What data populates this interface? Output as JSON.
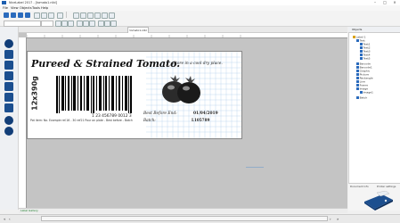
{
  "window": {
    "title": "NiceLabel 2017 - [tomato1.nlbl]"
  },
  "menu": {
    "items": [
      "File",
      "View",
      "Objects",
      "Tools",
      "Help"
    ]
  },
  "document": {
    "tab_label": "tomato1.nlbl"
  },
  "label": {
    "title": "Pureed & Strained Tomato.",
    "weight": "12x390g",
    "barcode_number": "1 23 456789 0012 3",
    "footnote": "Pot item: No. Example ref.16 - 30 ref21 Pour on plate - Best before - Batch",
    "store_text": "Store in a cool dry place.",
    "best_before_label": "Best Before End:",
    "best_before_value": "01/04/2019",
    "batch_label": "Batch:",
    "batch_value": "L105789"
  },
  "colors": {
    "accent": "#1c4f8f",
    "canvas": "#c4c4c4",
    "gallery": "#1b7e2a"
  },
  "bottom": {
    "gallery_label": "Label Gallery"
  },
  "right_panel": {
    "tab_label": "Objects",
    "tree": [
      "Label 1",
      "Text",
      "Text1",
      "Text2",
      "Text3",
      "Text4",
      "Text5",
      "Barcode",
      "Barcode1",
      "Graphic",
      "Picture",
      "Rectangle",
      "Line",
      "Frame",
      "Image",
      "Image1",
      "Batch"
    ],
    "footer_left": "Document Info",
    "footer_right": "Printer settings"
  }
}
